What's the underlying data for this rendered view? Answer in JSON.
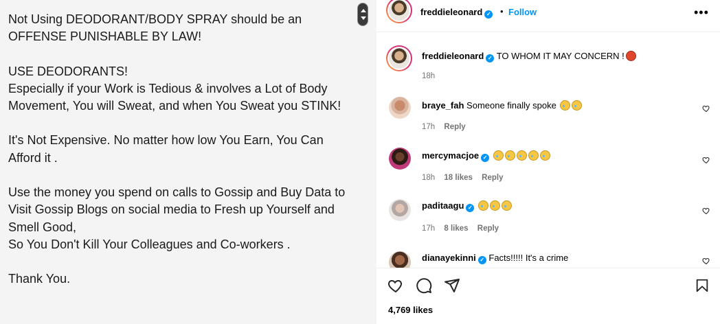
{
  "post": {
    "lines": [
      "Not Using DEODORANT/BODY SPRAY should be an",
      "OFFENSE PUNISHABLE BY LAW!",
      "",
      "USE DEODORANTS!",
      "Especially if your Work is Tedious  & involves a Lot of  Body",
      "Movement, You will Sweat, and when You Sweat you STINK!",
      "",
      "It's Not Expensive. No matter how low You Earn, You Can",
      "Afford it .",
      "",
      "Use the money you spend on calls to Gossip and Buy Data to",
      "Visit Gossip Blogs on social media to Fresh up Yourself and",
      "Smell Good,",
      "So You Don't Kill Your Colleagues and Co-workers .",
      "",
      "Thank You."
    ]
  },
  "header": {
    "username": "freddieleonard",
    "separator": "•",
    "follow_label": "Follow",
    "more_label": "•••"
  },
  "caption": {
    "username": "freddieleonard",
    "text": "TO WHOM IT MAY CONCERN !",
    "time": "18h"
  },
  "comments": [
    {
      "username": "braye_fah",
      "verified": false,
      "text": "Someone finally spoke",
      "emojis": 2,
      "time": "17h",
      "likes": "",
      "reply": "Reply"
    },
    {
      "username": "mercymacjoe",
      "verified": true,
      "text": "",
      "emojis": 5,
      "time": "18h",
      "likes": "18 likes",
      "reply": "Reply"
    },
    {
      "username": "paditaagu",
      "verified": true,
      "text": "",
      "emojis": 3,
      "time": "17h",
      "likes": "8 likes",
      "reply": "Reply"
    },
    {
      "username": "dianayekinni",
      "verified": true,
      "text": "Facts!!!!! It's a crime",
      "emojis": 0,
      "time": "",
      "likes": "",
      "reply": ""
    }
  ],
  "footer": {
    "likes": "4,769 likes"
  },
  "icons": {
    "like": "heart-icon",
    "comment": "comment-icon",
    "share": "paper-plane-icon",
    "save": "bookmark-icon"
  },
  "colors": {
    "accent": "#0095f6",
    "muted": "#737373"
  }
}
